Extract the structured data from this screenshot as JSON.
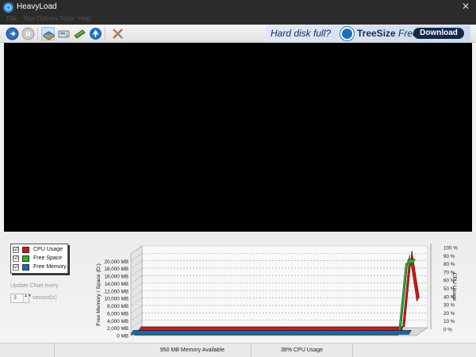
{
  "window": {
    "title": "HeavyLoad",
    "close_glyph": "✕"
  },
  "menu": [
    {
      "label": "File"
    },
    {
      "label": "Test Options"
    },
    {
      "label": "Tools"
    },
    {
      "label": "Help"
    }
  ],
  "toolbar": {
    "buttons": [
      {
        "icon": "start-icon"
      },
      {
        "icon": "pause-icon"
      },
      {
        "icon": "cpu-stress-icon",
        "active": true
      },
      {
        "icon": "disk-write-icon"
      },
      {
        "icon": "memory-icon"
      },
      {
        "icon": "treesize-icon"
      },
      {
        "icon": "settings-tools-icon"
      }
    ]
  },
  "ad": {
    "text": "Hard disk full?",
    "brand_bold": "TreeSize",
    "brand_rest": " Free",
    "button": "Download"
  },
  "legend": [
    {
      "label": "CPU Usage",
      "color": "#dd1111",
      "checked": true,
      "check_glyph": "☑"
    },
    {
      "label": "Free Space",
      "color": "#22bb22",
      "checked": true,
      "check_glyph": "☑"
    },
    {
      "label": "Free Memory",
      "color": "#1166cc",
      "checked": true,
      "check_glyph": "☑"
    }
  ],
  "update": {
    "label": "Update Chart every",
    "value": "3",
    "unit": "second(s)",
    "arrows": "▲▼"
  },
  "chart_data": {
    "type": "area",
    "ylabel_left": "Free Memory / Space (D:)",
    "ylabel_right": "CPU Usage",
    "left_ticks": [
      "0 MB",
      "2,000 MB",
      "4,000 MB",
      "6,000 MB",
      "8,000 MB",
      "10,000 MB",
      "12,000 MB",
      "14,000 MB",
      "16,000 MB",
      "18,000 MB",
      "20,000 MB"
    ],
    "right_ticks": [
      "0 %",
      "10 %",
      "20 %",
      "30 %",
      "40 %",
      "50 %",
      "60 %",
      "70 %",
      "80 %",
      "90 %",
      "100 %"
    ],
    "ylim_left": [
      0,
      22000
    ],
    "ylim_right": [
      0,
      100
    ],
    "points": 40,
    "series": [
      {
        "name": "CPU Usage",
        "color": "#dd1111",
        "axis": "right",
        "values": [
          2,
          2,
          2,
          2,
          2,
          2,
          2,
          2,
          2,
          2,
          2,
          2,
          2,
          2,
          2,
          2,
          2,
          2,
          2,
          2,
          2,
          2,
          2,
          2,
          2,
          2,
          2,
          2,
          2,
          2,
          2,
          2,
          2,
          2,
          2,
          2,
          2,
          95,
          38
        ]
      },
      {
        "name": "Free Space",
        "color": "#22bb22",
        "axis": "right",
        "values": [
          0,
          0,
          0,
          0,
          0,
          0,
          0,
          0,
          0,
          0,
          0,
          0,
          0,
          0,
          0,
          0,
          0,
          0,
          0,
          0,
          0,
          0,
          0,
          0,
          0,
          0,
          0,
          0,
          0,
          0,
          0,
          0,
          0,
          0,
          0,
          0,
          0,
          88,
          88
        ]
      },
      {
        "name": "Free Memory",
        "color": "#1166cc",
        "axis": "left",
        "values": [
          950,
          950,
          950,
          950,
          950,
          950,
          950,
          950,
          950,
          950,
          950,
          950,
          950,
          950,
          950,
          950,
          950,
          950,
          950,
          950,
          950,
          950,
          950,
          950,
          950,
          950,
          950,
          950,
          950,
          950,
          950,
          950,
          950,
          950,
          950,
          950,
          950,
          950,
          950
        ]
      }
    ],
    "grid": true
  },
  "status": {
    "memory": "950 MB Memory Available",
    "cpu": "38% CPU Usage"
  }
}
